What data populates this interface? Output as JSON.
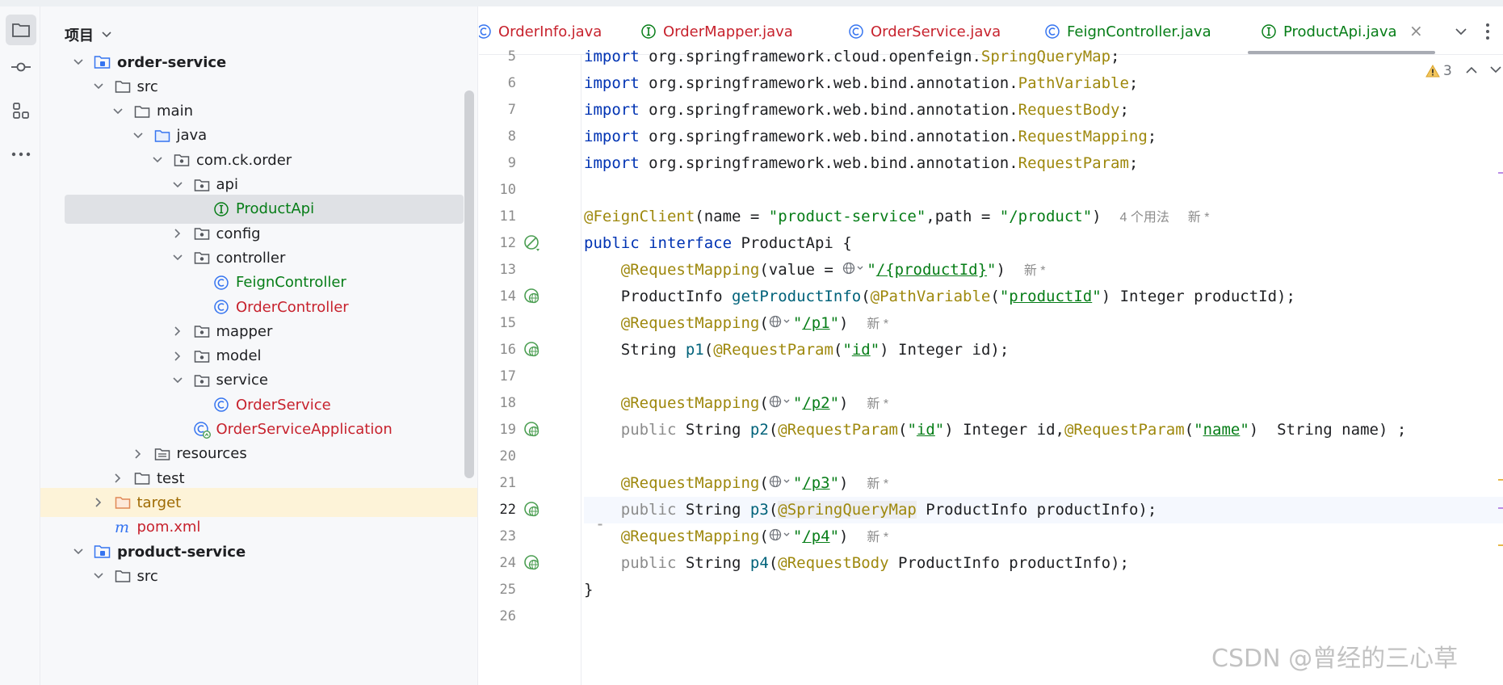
{
  "toolstrip": {
    "icons": [
      "folder-icon",
      "commit-icon",
      "structure-icon",
      "more-icon"
    ]
  },
  "project": {
    "title": "项目",
    "tree": [
      {
        "label": "order-service",
        "icon": "module-folder-icon",
        "expand": "open",
        "indent": 0,
        "style": "bold"
      },
      {
        "label": "src",
        "icon": "folder-icon",
        "expand": "open",
        "indent": 1,
        "style": "normal"
      },
      {
        "label": "main",
        "icon": "folder-icon",
        "expand": "open",
        "indent": 2,
        "style": "normal"
      },
      {
        "label": "java",
        "icon": "source-folder-icon",
        "expand": "open",
        "indent": 3,
        "style": "normal"
      },
      {
        "label": "com.ck.order",
        "icon": "package-icon",
        "expand": "open",
        "indent": 4,
        "style": "normal"
      },
      {
        "label": "api",
        "icon": "package-icon",
        "expand": "open",
        "indent": 5,
        "style": "normal"
      },
      {
        "label": "ProductApi",
        "icon": "interface-icon",
        "expand": "none",
        "indent": 6,
        "style": "green",
        "selected": true
      },
      {
        "label": "config",
        "icon": "package-icon",
        "expand": "closed",
        "indent": 5,
        "style": "normal"
      },
      {
        "label": "controller",
        "icon": "package-icon",
        "expand": "open",
        "indent": 5,
        "style": "normal"
      },
      {
        "label": "FeignController",
        "icon": "class-icon",
        "expand": "none",
        "indent": 6,
        "style": "green"
      },
      {
        "label": "OrderController",
        "icon": "class-icon",
        "expand": "none",
        "indent": 6,
        "style": "red"
      },
      {
        "label": "mapper",
        "icon": "package-icon",
        "expand": "closed",
        "indent": 5,
        "style": "normal"
      },
      {
        "label": "model",
        "icon": "package-icon",
        "expand": "closed",
        "indent": 5,
        "style": "normal"
      },
      {
        "label": "service",
        "icon": "package-icon",
        "expand": "open",
        "indent": 5,
        "style": "normal"
      },
      {
        "label": "OrderService",
        "icon": "class-icon",
        "expand": "none",
        "indent": 6,
        "style": "red"
      },
      {
        "label": "OrderServiceApplication",
        "icon": "spring-class-icon",
        "expand": "none",
        "indent": 5,
        "style": "red"
      },
      {
        "label": "resources",
        "icon": "resources-folder-icon",
        "expand": "closed",
        "indent": 3,
        "style": "normal"
      },
      {
        "label": "test",
        "icon": "folder-icon",
        "expand": "closed",
        "indent": 2,
        "style": "normal"
      },
      {
        "label": "target",
        "icon": "excluded-folder-icon",
        "expand": "closed",
        "indent": 1,
        "style": "brown",
        "highlight": true
      },
      {
        "label": "pom.xml",
        "icon": "maven-icon",
        "expand": "none",
        "indent": 1,
        "style": "red"
      },
      {
        "label": "product-service",
        "icon": "module-folder-icon",
        "expand": "open",
        "indent": 0,
        "style": "bold"
      },
      {
        "label": "src",
        "icon": "folder-icon",
        "expand": "open",
        "indent": 1,
        "style": "normal"
      }
    ]
  },
  "tabs": [
    {
      "label": "OrderInfo.java",
      "icon": "class-icon",
      "color": "#c7222d"
    },
    {
      "label": "OrderMapper.java",
      "icon": "interface-icon",
      "color": "#c7222d"
    },
    {
      "label": "OrderService.java",
      "icon": "class-icon",
      "color": "#c7222d"
    },
    {
      "label": "FeignController.java",
      "icon": "class-icon",
      "color": "#067d17"
    },
    {
      "label": "ProductApi.java",
      "icon": "interface-icon",
      "color": "#067d17",
      "active": true
    }
  ],
  "editor": {
    "warnings_count": "3",
    "lines": [
      {
        "n": "5"
      },
      {
        "n": "6"
      },
      {
        "n": "7"
      },
      {
        "n": "8"
      },
      {
        "n": "9"
      },
      {
        "n": "10"
      },
      {
        "n": "11"
      },
      {
        "n": "12",
        "gutter": "spring-bean-icon"
      },
      {
        "n": "13"
      },
      {
        "n": "14",
        "gutter": "web-endpoint-icon"
      },
      {
        "n": "15"
      },
      {
        "n": "16",
        "gutter": "web-endpoint-icon"
      },
      {
        "n": "17"
      },
      {
        "n": "18"
      },
      {
        "n": "19",
        "gutter": "web-endpoint-icon"
      },
      {
        "n": "20"
      },
      {
        "n": "21"
      },
      {
        "n": "22",
        "gutter": "web-endpoint-icon",
        "current": true
      },
      {
        "n": "23"
      },
      {
        "n": "24",
        "gutter": "web-endpoint-icon"
      },
      {
        "n": "25"
      },
      {
        "n": "26"
      }
    ],
    "code": {
      "l5_kw": "import",
      "l5_pkg": " org.springframework.cloud.openfeign.",
      "l5_cls": "SpringQueryMap",
      "l5_end": ";",
      "l6_kw": "import",
      "l6_pkg": " org.springframework.web.bind.annotation.",
      "l6_cls": "PathVariable",
      "l6_end": ";",
      "l7_kw": "import",
      "l7_pkg": " org.springframework.web.bind.annotation.",
      "l7_cls": "RequestBody",
      "l7_end": ";",
      "l8_kw": "import",
      "l8_pkg": " org.springframework.web.bind.annotation.",
      "l8_cls": "RequestMapping",
      "l8_end": ";",
      "l9_kw": "import",
      "l9_pkg": " org.springframework.web.bind.annotation.",
      "l9_cls": "RequestParam",
      "l9_end": ";",
      "l11_ann": "@FeignClient",
      "l11_a": "(name = ",
      "l11_s1": "\"product-service\"",
      "l11_b": ",path = ",
      "l11_s2": "\"/product\"",
      "l11_c": ")",
      "l11_hint1": "4 个用法",
      "l11_hint2": "新 *",
      "l12_kw1": "public",
      "l12_kw2": "interface",
      "l12_name": " ProductApi {",
      "l13_ann": "@RequestMapping",
      "l13_a": "(value = ",
      "l13_s_open": "\"",
      "l13_s_path": "/{productId}",
      "l13_s_close": "\"",
      "l13_c": ")",
      "l13_hint": "新 *",
      "l14_type": "ProductInfo ",
      "l14_fn": "getProductInfo",
      "l14_a": "(",
      "l14_ann": "@PathVariable",
      "l14_b": "(",
      "l14_s_open": "\"",
      "l14_s_val": "productId",
      "l14_s_close": "\"",
      "l14_c": ") Integer productId);",
      "l15_ann": "@RequestMapping",
      "l15_a": "(",
      "l15_s_open": "\"",
      "l15_s_path": "/p1",
      "l15_s_close": "\"",
      "l15_c": ")",
      "l15_hint": "新 *",
      "l16_type": "String ",
      "l16_fn": "p1",
      "l16_a": "(",
      "l16_ann": "@RequestParam",
      "l16_b": "(",
      "l16_s_open": "\"",
      "l16_s_val": "id",
      "l16_s_close": "\"",
      "l16_c": ") Integer id);",
      "l18_ann": "@RequestMapping",
      "l18_a": "(",
      "l18_s_open": "\"",
      "l18_s_path": "/p2",
      "l18_s_close": "\"",
      "l18_c": ")",
      "l18_hint": "新 *",
      "l19_pub": "public",
      "l19_type": " String ",
      "l19_fn": "p2",
      "l19_a": "(",
      "l19_ann1": "@RequestParam",
      "l19_b": "(",
      "l19_s1_open": "\"",
      "l19_s1_val": "id",
      "l19_s1_close": "\"",
      "l19_c": ") Integer id,",
      "l19_ann2": "@RequestParam",
      "l19_d": "(",
      "l19_s2_open": "\"",
      "l19_s2_val": "name",
      "l19_s2_close": "\"",
      "l19_e": ")  String name) ;",
      "l21_ann": "@RequestMapping",
      "l21_a": "(",
      "l21_s_open": "\"",
      "l21_s_path": "/p3",
      "l21_s_close": "\"",
      "l21_c": ")",
      "l21_hint": "新 *",
      "l22_pub": "public",
      "l22_type": " String ",
      "l22_fn": "p3",
      "l22_a": "(",
      "l22_ann": "@SpringQueryMap",
      "l22_c": " ProductInfo productInfo);",
      "l23_ann": "@RequestMapping",
      "l23_a": "(",
      "l23_s_open": "\"",
      "l23_s_path": "/p4",
      "l23_s_close": "\"",
      "l23_c": ")",
      "l23_hint": "新 *",
      "l24_pub": "public",
      "l24_type": " String ",
      "l24_fn": "p4",
      "l24_a": "(",
      "l24_ann": "@RequestBody",
      "l24_c": " ProductInfo productInfo);",
      "l25": "}"
    }
  },
  "watermark": "CSDN @曾经的三心草",
  "colors": {
    "keyword": "#0033b3",
    "annotation": "#9e880d",
    "string": "#067d17",
    "method": "#00627a",
    "error_red": "#c7222d"
  }
}
